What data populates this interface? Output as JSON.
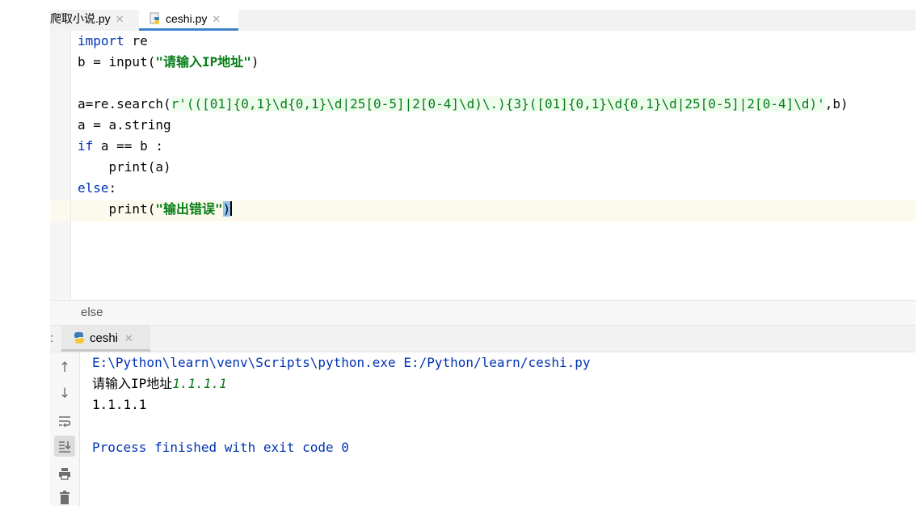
{
  "tabs": [
    {
      "label": "爬取小说.py",
      "active": false
    },
    {
      "label": "ceshi.py",
      "active": true
    }
  ],
  "editor": {
    "line1": {
      "kw": "import",
      "rest": " re"
    },
    "line2": {
      "prefix": "b = input(",
      "str": "\"请输入IP地址\"",
      "suffix": ")"
    },
    "line4": {
      "prefix": "a=re.search(",
      "rprefix": "r'",
      "regex": "(([01]{0,1}\\d{0,1}\\d|25[0-5]|2[0-4]\\d)\\.){3}([01]{0,1}\\d{0,1}\\d|25[0-5]|2[0-4]\\d)",
      "rsuffix": "'",
      "suffix": ",b)"
    },
    "line5": {
      "text": "a = a.string"
    },
    "line6": {
      "kw": "if",
      "rest": " a == b :"
    },
    "line7": {
      "text": "    print(a)"
    },
    "line8": {
      "kw": "else",
      "rest": ":"
    },
    "line9": {
      "prefix": "    print(",
      "str": "\"输出错误\"",
      "suffix": ")"
    }
  },
  "breadcrumb": {
    "item": "else"
  },
  "run": {
    "colon": ":",
    "tab_label": "ceshi",
    "console": {
      "command": "E:\\Python\\learn\\venv\\Scripts\\python.exe E:/Python/learn/ceshi.py",
      "prompt": "请输入IP地址",
      "user_input": "1.1.1.1",
      "output": "1.1.1.1",
      "finished": "Process finished with exit code 0"
    },
    "toolbar_icons": [
      "arrow-up-icon",
      "arrow-down-icon",
      "soft-wrap-icon",
      "scroll-to-end-icon",
      "print-icon",
      "trash-icon"
    ]
  },
  "colors": {
    "keyword": "#0033b3",
    "string": "#067d17",
    "tab_active_underline": "#4083c9",
    "current_line": "#fcfaed"
  }
}
